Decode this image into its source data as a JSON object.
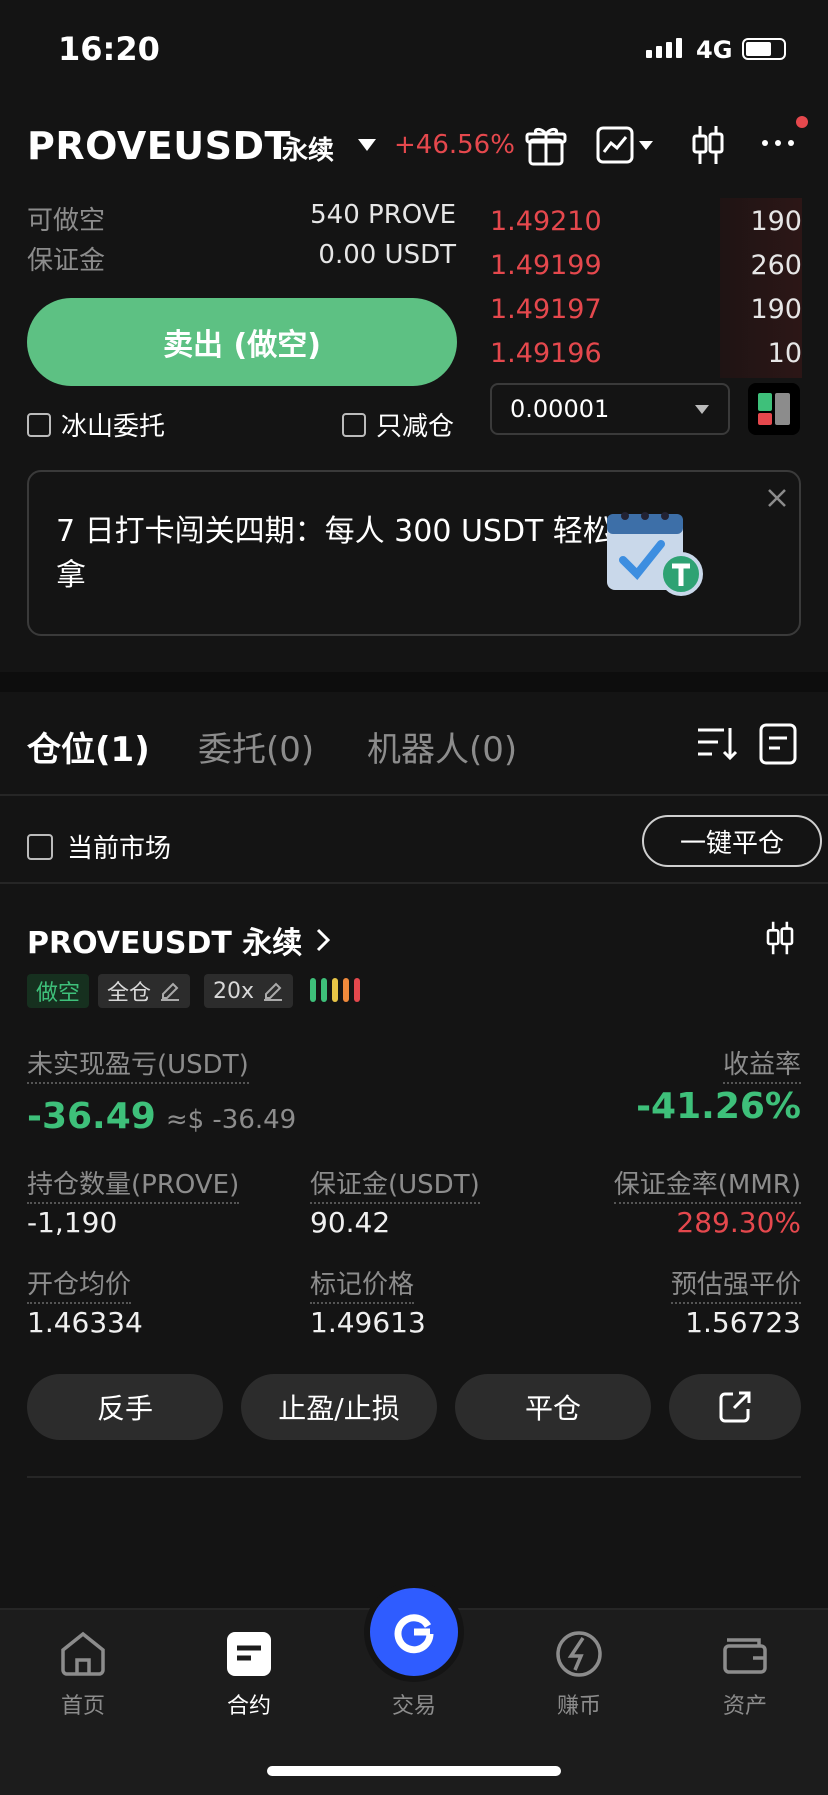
{
  "status_bar": {
    "time": "16:20",
    "network": "4G"
  },
  "header": {
    "pair": "PROVEUSDT",
    "type": "永续",
    "change": "+46.56%",
    "icons": [
      "gift-icon",
      "chart-line-icon",
      "candlestick-icon",
      "more-icon"
    ]
  },
  "order_panel": {
    "short_label": "可做空",
    "short_value": "540 PROVE",
    "margin_label": "保证金",
    "margin_value": "0.00 USDT",
    "sell_button": "卖出 (做空)",
    "iceberg_label": "冰山委托",
    "reduce_only_label": "只减仓"
  },
  "orderbook": {
    "asks": [
      {
        "price": "1.49210",
        "qty": "190"
      },
      {
        "price": "1.49199",
        "qty": "260"
      },
      {
        "price": "1.49197",
        "qty": "190"
      },
      {
        "price": "1.49196",
        "qty": "10"
      }
    ],
    "tick_size": "0.00001"
  },
  "banner": {
    "text": "7 日打卡闯关四期：每人 300 USDT 轻松拿"
  },
  "tabs": [
    {
      "label": "仓位(1)",
      "active": true
    },
    {
      "label": "委托(0)",
      "active": false
    },
    {
      "label": "机器人(0)",
      "active": false
    }
  ],
  "filter": {
    "current_market": "当前市场",
    "close_all": "一键平仓"
  },
  "position": {
    "title": "PROVEUSDT 永续",
    "side_badge": "做空",
    "mode_badge": "全仓",
    "leverage_badge": "20x",
    "pnl_label": "未实现盈亏(USDT)",
    "pnl_value": "-36.49",
    "pnl_approx": "≈$ -36.49",
    "roe_label": "收益率",
    "roe_value": "-41.26%",
    "qty_label": "持仓数量(PROVE)",
    "qty_value": "-1,190",
    "margin_label": "保证金(USDT)",
    "margin_value": "90.42",
    "mmr_label": "保证金率(MMR)",
    "mmr_value": "289.30%",
    "entry_label": "开仓均价",
    "entry_value": "1.46334",
    "mark_label": "标记价格",
    "mark_value": "1.49613",
    "liq_label": "预估强平价",
    "liq_value": "1.56723",
    "actions": {
      "reverse": "反手",
      "tpsl": "止盈/止损",
      "close": "平仓"
    }
  },
  "bottom_nav": [
    {
      "label": "首页",
      "icon": "home-icon",
      "active": false
    },
    {
      "label": "合约",
      "icon": "futures-icon",
      "active": true
    },
    {
      "label": "交易",
      "icon": "trade-icon",
      "active": false
    },
    {
      "label": "赚币",
      "icon": "earn-icon",
      "active": false
    },
    {
      "label": "资产",
      "icon": "wallet-icon",
      "active": false
    }
  ],
  "colors": {
    "sell": "#5dc183",
    "ask": "#e5484d",
    "profit_negative": "#3ec07a",
    "accent": "#2f5cff"
  }
}
